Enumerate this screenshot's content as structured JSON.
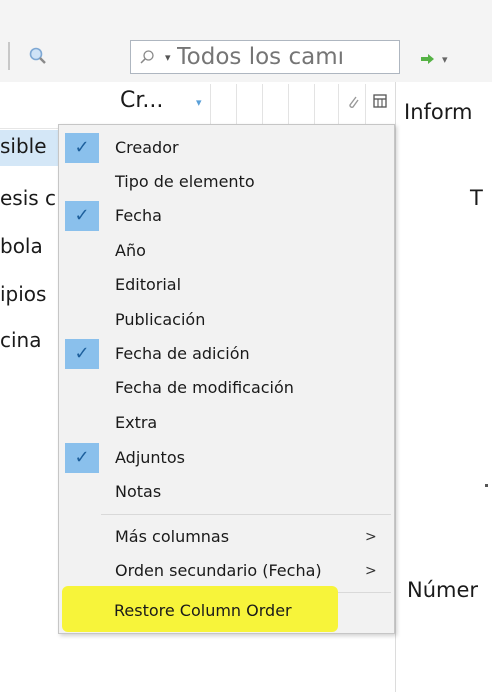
{
  "toolbar": {
    "search_placeholder": "Todos los camı",
    "search_mode_caret": "▾",
    "arrow_caret": "▾"
  },
  "column_header": {
    "title": "Cr...",
    "sort_indicator": "▾"
  },
  "rows": [
    "sible",
    "esis c",
    "bola",
    "ipios",
    "cina"
  ],
  "right_pane": {
    "header": "Inform",
    "letter_t": "T",
    "label": "Númer"
  },
  "menu": {
    "items": [
      {
        "label": "Creador",
        "checked": true
      },
      {
        "label": "Tipo de elemento",
        "checked": false
      },
      {
        "label": "Fecha",
        "checked": true
      },
      {
        "label": "Año",
        "checked": false
      },
      {
        "label": "Editorial",
        "checked": false
      },
      {
        "label": "Publicación",
        "checked": false
      },
      {
        "label": "Fecha de adición",
        "checked": true
      },
      {
        "label": "Fecha de modificación",
        "checked": false
      },
      {
        "label": "Extra",
        "checked": false
      },
      {
        "label": "Adjuntos",
        "checked": true
      },
      {
        "label": "Notas",
        "checked": false
      }
    ],
    "more_columns": "Más columnas",
    "secondary_sort": "Orden secundario (Fecha)",
    "restore_order": "Restore Column Order",
    "submenu_chevron": ">"
  },
  "colors": {
    "check_bg": "#8ac0ec",
    "highlight": "#f7f43a",
    "menu_bg": "#f2f2f2"
  }
}
